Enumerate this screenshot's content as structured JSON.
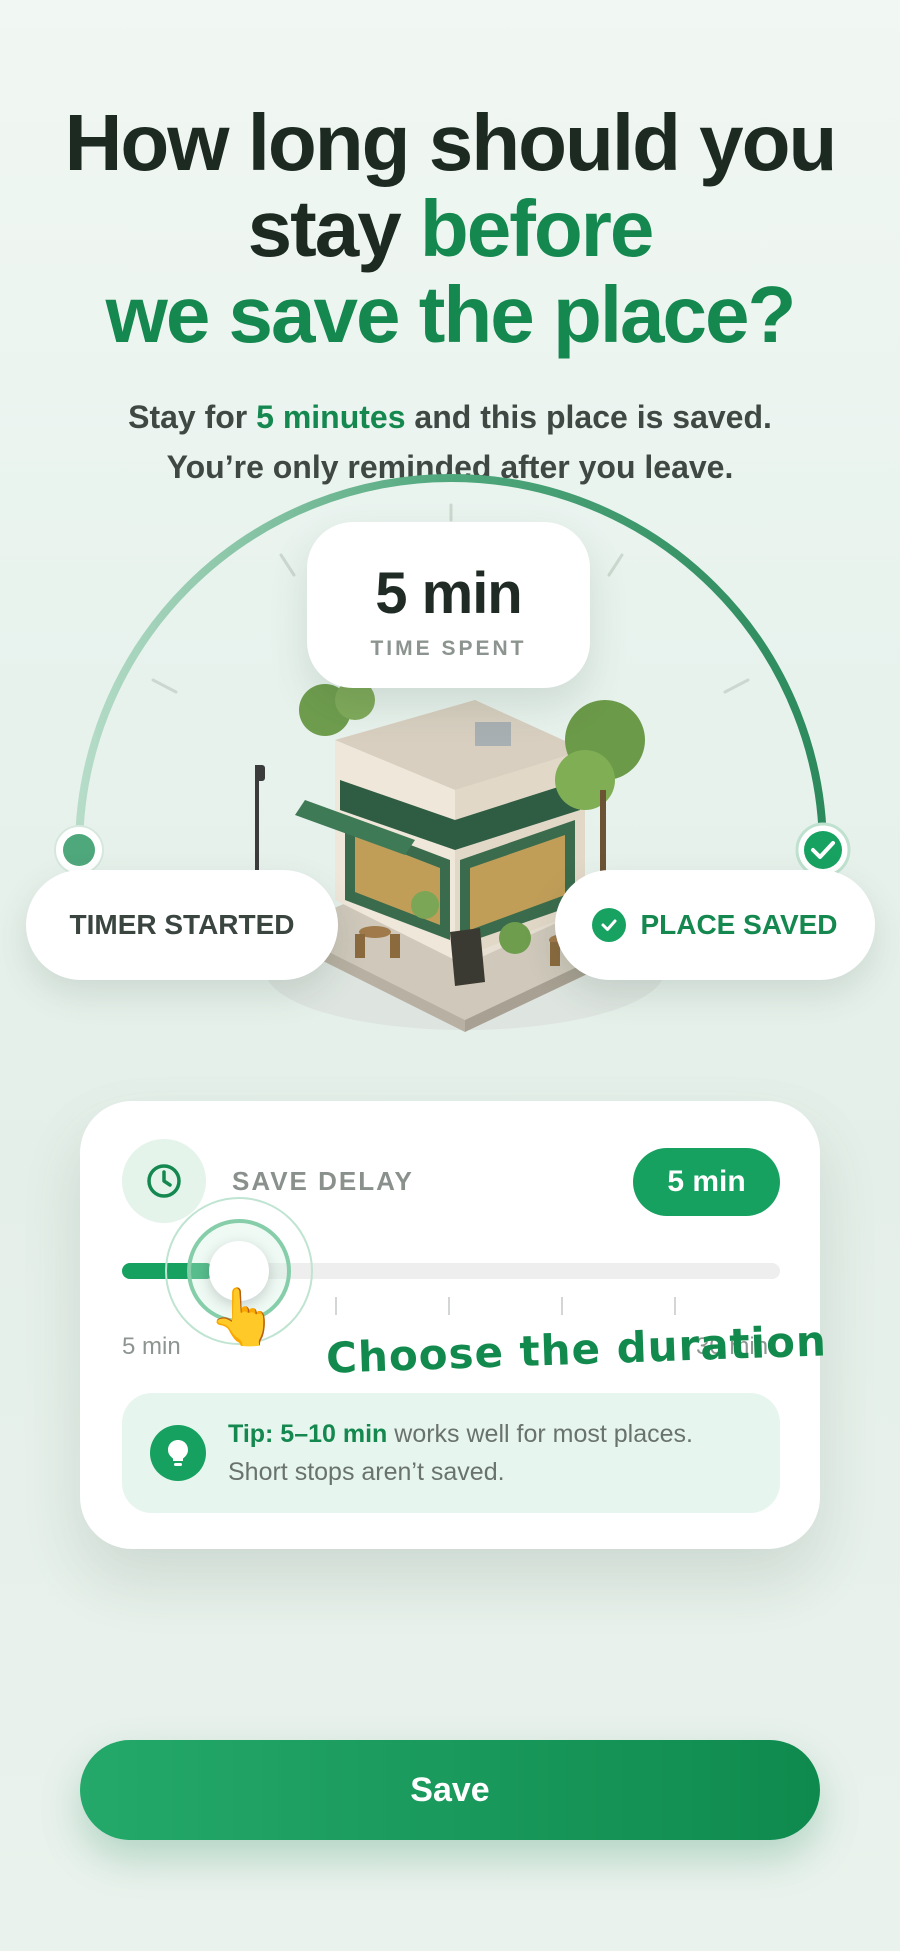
{
  "header": {
    "title_line1": "How long should you",
    "title_line2_plain": "stay ",
    "title_line2_accent": "before",
    "title_line3_accent": "we save the place?",
    "subtitle_pre": "Stay for ",
    "subtitle_accent": "5 minutes",
    "subtitle_post": " and this place is saved.",
    "subtitle_line2": "You’re only reminded after you leave."
  },
  "timer": {
    "value": "5 min",
    "label": "TIME SPENT",
    "start_label": "TIMER STARTED",
    "end_label": "PLACE SAVED"
  },
  "delay_card": {
    "title": "SAVE DELAY",
    "value": "5 min",
    "slider_fraction": 0.14,
    "range_min": "5 min",
    "range_max": "30 min",
    "annotation": "Choose the duration",
    "tip_bold": "Tip: 5–10 min",
    "tip_rest": " works well for most places.",
    "tip_line2": "Short stops aren’t saved."
  },
  "actions": {
    "save_label": "Save"
  },
  "colors": {
    "accent": "#14884f",
    "button": "#17a160",
    "background": "#eaf3ee"
  },
  "icons": [
    "clock-icon",
    "check-icon",
    "lightbulb-icon",
    "pointing-hand-icon"
  ]
}
